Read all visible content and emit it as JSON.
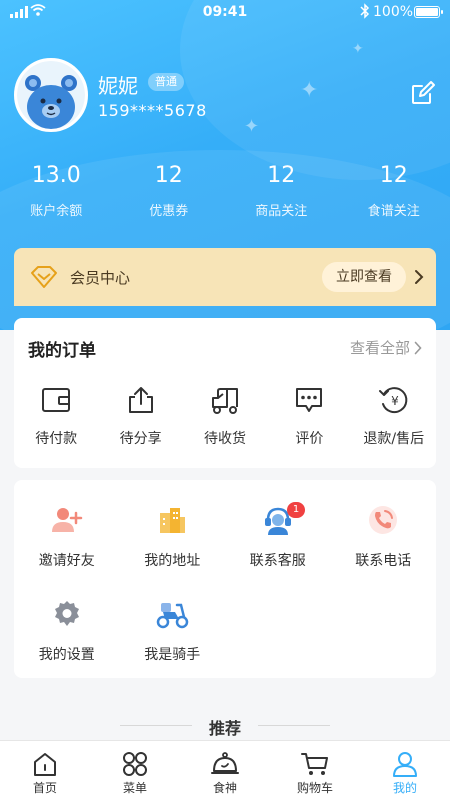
{
  "status_bar": {
    "time": "09:41",
    "battery": "100%"
  },
  "profile": {
    "name": "妮妮",
    "level": "普通",
    "phone": "159****5678"
  },
  "stats": [
    {
      "value": "13.0",
      "label": "账户余额"
    },
    {
      "value": "12",
      "label": "优惠券"
    },
    {
      "value": "12",
      "label": "商品关注"
    },
    {
      "value": "12",
      "label": "食谱关注"
    }
  ],
  "vip": {
    "title": "会员中心",
    "button": "立即查看"
  },
  "orders": {
    "title": "我的订单",
    "view_all": "查看全部",
    "items": [
      {
        "label": "待付款",
        "icon": "wallet-icon"
      },
      {
        "label": "待分享",
        "icon": "share-icon"
      },
      {
        "label": "待收货",
        "icon": "truck-icon"
      },
      {
        "label": "评价",
        "icon": "comment-icon"
      },
      {
        "label": "退款/售后",
        "icon": "refund-icon"
      }
    ]
  },
  "services": [
    {
      "label": "邀请好友",
      "icon": "invite-friend-icon"
    },
    {
      "label": "我的地址",
      "icon": "address-icon"
    },
    {
      "label": "联系客服",
      "icon": "customer-service-icon",
      "badge": "1"
    },
    {
      "label": "联系电话",
      "icon": "phone-icon"
    },
    {
      "label": "我的设置",
      "icon": "settings-icon"
    },
    {
      "label": "我是骑手",
      "icon": "rider-icon"
    }
  ],
  "recommend_title": "推荐",
  "tabs": [
    {
      "label": "首页",
      "icon": "home-icon"
    },
    {
      "label": "菜单",
      "icon": "menu-icon"
    },
    {
      "label": "食神",
      "icon": "chef-icon"
    },
    {
      "label": "购物车",
      "icon": "cart-icon"
    },
    {
      "label": "我的",
      "icon": "user-icon",
      "active": true
    }
  ],
  "colors": {
    "primary": "#35aef8",
    "vip_bg": "#f7e4b7",
    "badge": "#f04141"
  }
}
